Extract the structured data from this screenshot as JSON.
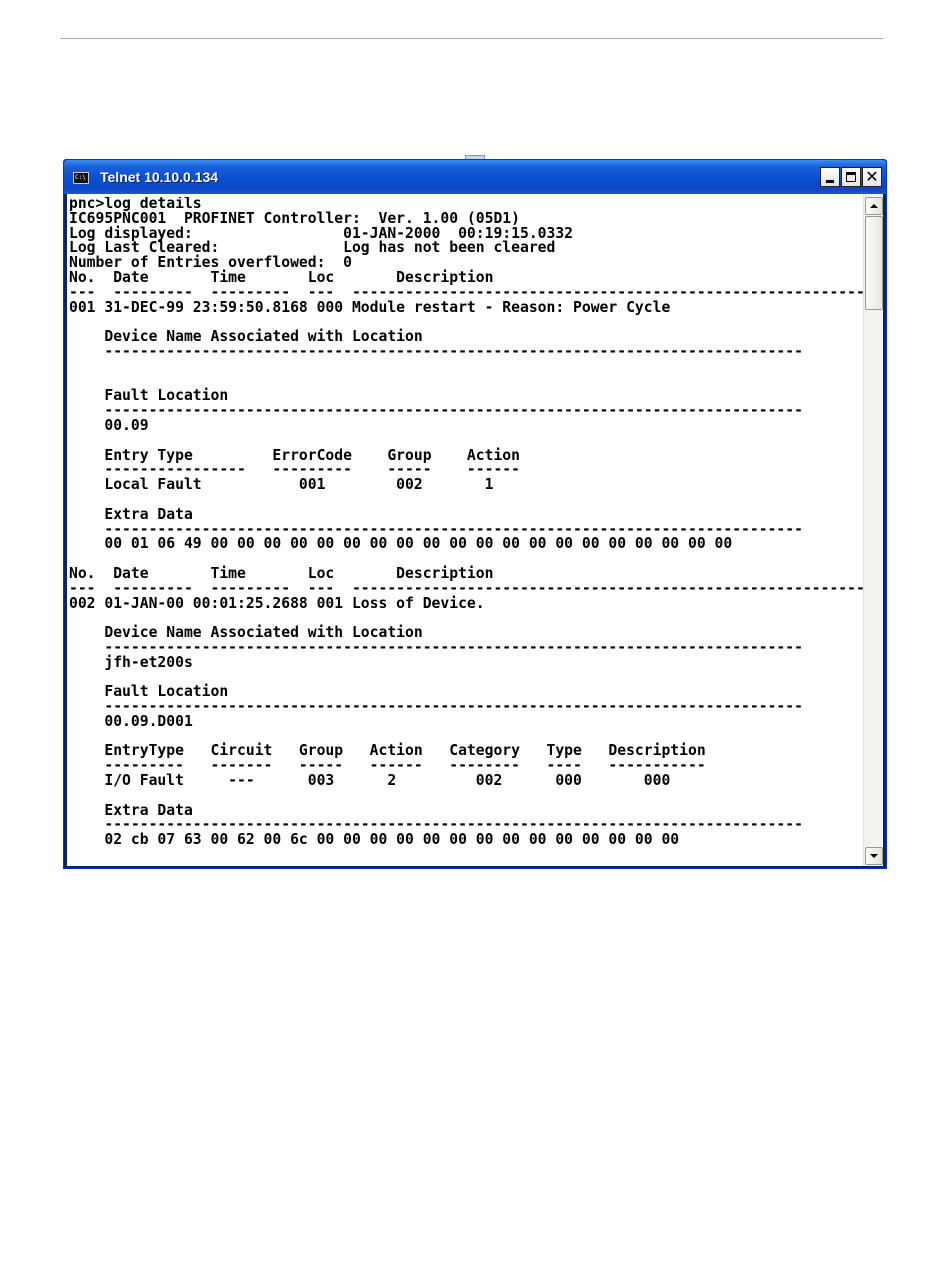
{
  "window": {
    "title": "Telnet 10.10.0.134",
    "icon": "console-icon",
    "icon_text": "C:\\",
    "minimize_label": "_",
    "maximize_label": "□",
    "close_label": "✕"
  },
  "terminal": {
    "lines": [
      "pnc>log details",
      "IC695PNC001  PROFINET Controller:  Ver. 1.00 (05D1)",
      "Log displayed:                 01-JAN-2000  00:19:15.0332",
      "Log Last Cleared:              Log has not been cleared",
      "Number of Entries overflowed:  0",
      "No.  Date       Time       Loc       Description",
      "---  ---------  ---------  ---  ------------------------------------------------------------",
      "001 31-DEC-99 23:59:50.8168 000 Module restart - Reason: Power Cycle",
      "",
      "    Device Name Associated with Location",
      "    -------------------------------------------------------------------------------",
      "",
      "",
      "    Fault Location",
      "    -------------------------------------------------------------------------------",
      "    00.09",
      "",
      "    Entry Type         ErrorCode    Group    Action",
      "    ----------------   ---------    -----    ------",
      "    Local Fault           001        002       1",
      "",
      "    Extra Data",
      "    -------------------------------------------------------------------------------",
      "    00 01 06 49 00 00 00 00 00 00 00 00 00 00 00 00 00 00 00 00 00 00 00 00",
      "",
      "No.  Date       Time       Loc       Description",
      "---  ---------  ---------  ---  ------------------------------------------------------------",
      "002 01-JAN-00 00:01:25.2688 001 Loss of Device.",
      "",
      "    Device Name Associated with Location",
      "    -------------------------------------------------------------------------------",
      "    jfh-et200s",
      "",
      "    Fault Location",
      "    -------------------------------------------------------------------------------",
      "    00.09.D001",
      "",
      "    EntryType   Circuit   Group   Action   Category   Type   Description",
      "    ---------   -------   -----   ------   --------   ----   -----------",
      "    I/O Fault     ---      003      2         002      000       000",
      "",
      "    Extra Data",
      "    -------------------------------------------------------------------------------",
      "    02 cb 07 63 00 62 00 6c 00 00 00 00 00 00 00 00 00 00 00 00 00 00"
    ]
  }
}
